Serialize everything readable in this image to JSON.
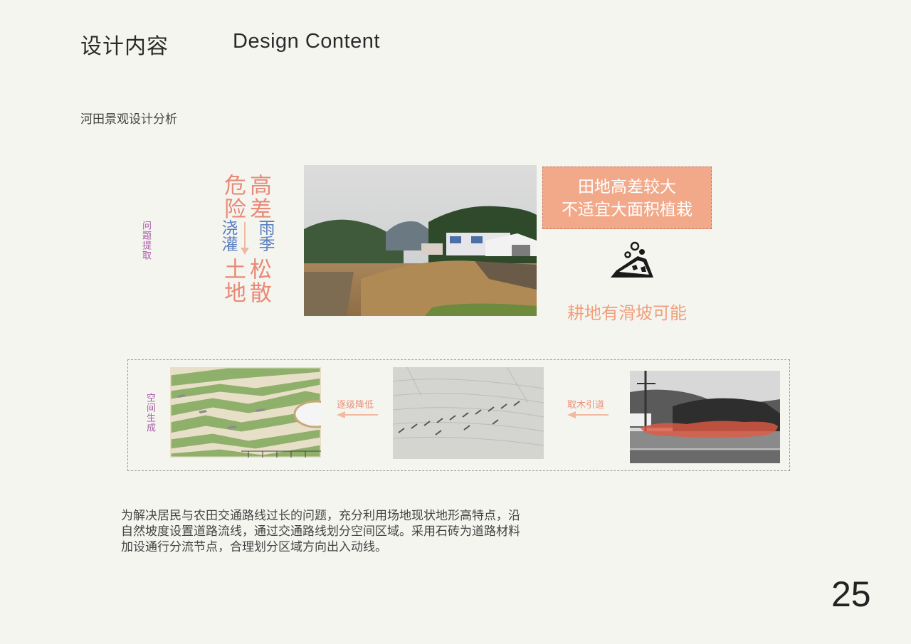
{
  "header": {
    "title_cn": "设计内容",
    "title_en": "Design Content"
  },
  "section": {
    "subtitle": "河田景观设计分析"
  },
  "problem": {
    "label": "问题提取",
    "col_left_top": "危险",
    "col_left_mid": "浇灌",
    "col_left_bottom": "土地",
    "col_right_top": "高差",
    "col_right_mid": "雨季",
    "col_right_bottom": "松散",
    "callout_line1": "田地高差较大",
    "callout_line2": "不适宜大面积植栽",
    "landslide_icon": "landslide-icon",
    "risk_text": "耕地有滑坡可能"
  },
  "generation": {
    "label": "空间生成",
    "arrow1_label": "逐级降低",
    "arrow2_label": "取木引道"
  },
  "description": {
    "line1": "为解决居民与农田交通路线过长的问题，充分利用场地现状地形高特点，沿",
    "line2": "自然坡度设置道路流线，通过交通路线划分空间区域。采用石砖为道路材料",
    "line3": "加设通行分流节点，合理划分区域方向出入动线。"
  },
  "page": {
    "number": "25"
  },
  "colors": {
    "accent_pink": "#e88a78",
    "accent_blue": "#5b7fc0",
    "callout_bg": "#f1a98a",
    "label_purple": "#a85aa8"
  }
}
